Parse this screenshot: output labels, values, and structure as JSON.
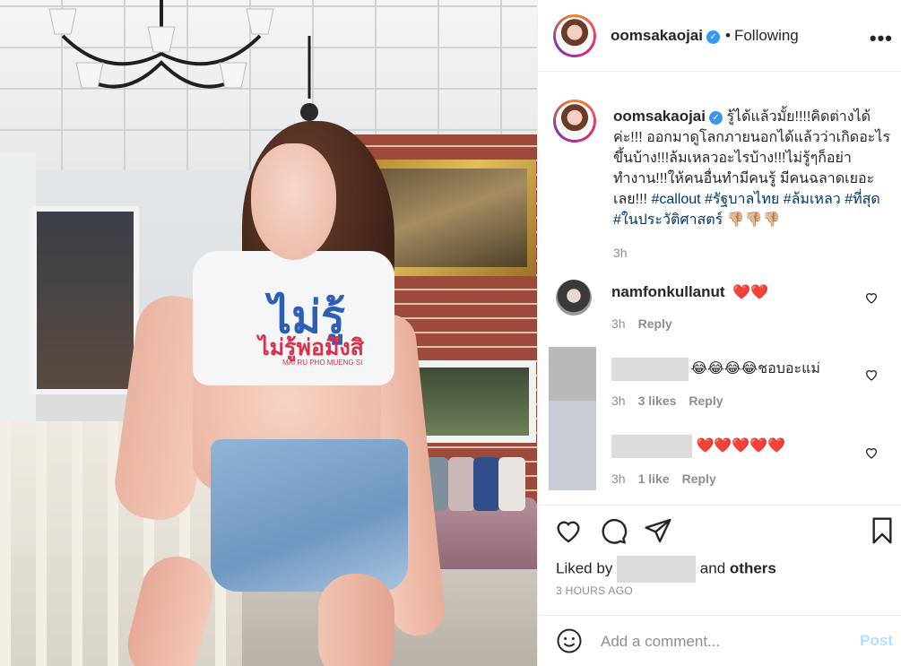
{
  "photo": {
    "shirt_line_1": "ไม่รู้",
    "shirt_line_2": "ไม่รู้พ่อมึงสิ",
    "shirt_line_3": "MAI RU PHO MUENG SI"
  },
  "header": {
    "username": "oomsakaojai",
    "separator": "•",
    "follow_status": "Following",
    "more_label": "•••"
  },
  "caption": {
    "username": "oomsakaojai",
    "text": "รู้ได้แล้วมั้ย!!!!คิดต่างได้ค่ะ!!! ออกมาดูโลกภายนอกได้แล้วว่าเกิดอะไรขึ้นบ้าง!!!ล้มเหลวอะไรบ้าง!!!ไม่รู้ๆก็อย่าทำงาน!!!ให้คนอื่นทำมีคนรู้ มีคนฉลาดเยอะเลย!!! ",
    "hashtags": "#callout #รัฐบาลไทย #ล้มเหลว #ที่สุด #ในประวัติศาสตร์",
    "emoji": "👎🏼👎🏼👎🏼",
    "time": "3h"
  },
  "comments": [
    {
      "username": "namfonkullanut",
      "text": "❤️❤️",
      "time": "3h",
      "likes": "",
      "reply": "Reply"
    },
    {
      "username": "",
      "text": "😂😂😂😂ชอบอะแม่",
      "time": "3h",
      "likes": "3 likes",
      "reply": "Reply"
    },
    {
      "username": "",
      "text": "❤️❤️❤️❤️❤️",
      "time": "3h",
      "likes": "1 like",
      "reply": "Reply"
    }
  ],
  "actions": {
    "liked_by_prefix": "Liked by",
    "liked_by_suffix": "and",
    "liked_by_others": "others",
    "timestamp": "3 HOURS AGO"
  },
  "add_comment": {
    "placeholder": "Add a comment...",
    "post_label": "Post"
  },
  "colors": {
    "link": "#00376b",
    "verified": "#3897f0",
    "post_disabled": "#b2dffc",
    "muted": "#8e8e8e"
  },
  "icons": [
    "verified-icon",
    "more-icon",
    "heart-icon",
    "comment-icon",
    "share-icon",
    "bookmark-icon",
    "emoji-icon"
  ]
}
